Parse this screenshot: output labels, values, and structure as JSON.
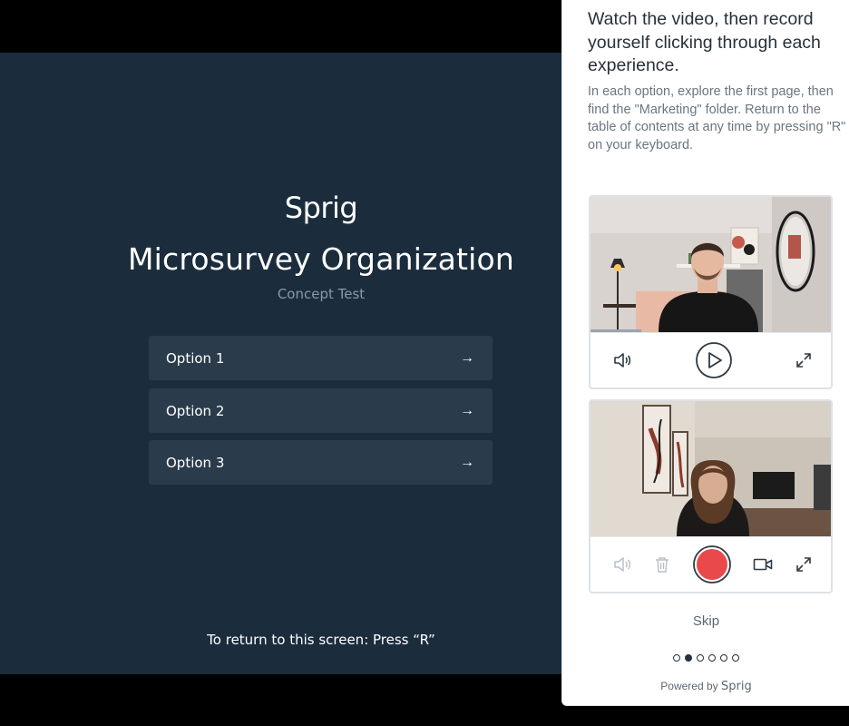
{
  "prototype": {
    "logo": "Sprig",
    "title": "Microsurvey Organization",
    "subtitle": "Concept Test",
    "options": [
      {
        "label": "Option 1",
        "arrow": "→"
      },
      {
        "label": "Option 2",
        "arrow": "→"
      },
      {
        "label": "Option 3",
        "arrow": "→"
      }
    ],
    "footer": "To return to this screen: Press “R”"
  },
  "panel": {
    "title": "Watch the video, then record yourself clicking through each experience.",
    "description": "In each option, explore the first page, then find the \"Marketing\" folder. Return to the table of contents at any time by pressing \"R\" on your keyboard.",
    "instruction_video": {
      "controls": [
        "volume-icon",
        "play-icon",
        "expand-icon"
      ]
    },
    "recording": {
      "controls": [
        "volume-icon",
        "trash-icon",
        "record-button",
        "camera-icon",
        "expand-icon"
      ],
      "record_color": "#e9494b"
    },
    "skip_label": "Skip",
    "pagination": {
      "total": 6,
      "active_index": 1
    },
    "powered_by": "Powered by",
    "powered_brand": "Sprig"
  },
  "colors": {
    "prototype_bg": "#1b2d3d",
    "option_bg": "#2a3b4b",
    "record": "#e9494b"
  }
}
